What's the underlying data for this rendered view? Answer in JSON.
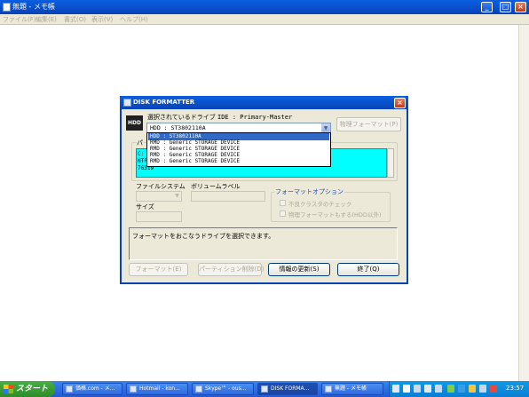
{
  "notepad": {
    "title": "無題 - メモ帳",
    "menu": [
      "ファイル(F)",
      "編集(E)",
      "書式(O)",
      "表示(V)",
      "ヘルプ(H)"
    ],
    "buttons": {
      "minimize": "_",
      "maximize": "□",
      "close": "×"
    }
  },
  "dialog": {
    "title": "DISK FORMATTER",
    "close": "×",
    "hdd_icon": "HDD",
    "selected_drive_label": "選択されているドライブ",
    "ide_label": "IDE : Primary-Master",
    "drive_value": "HDD : ST3802110A",
    "drive_options": [
      "HDD : ST3802110A",
      "RMD : Generic STORAGE DEVICE",
      "RMD : Generic STORAGE DEVICE",
      "RMD : Generic STORAGE DEVICE",
      "RMD : Generic STORAGE DEVICE"
    ],
    "physical_format_button": "物理フォーマット(P)",
    "partition_label": "パ",
    "partition_lines": [
      "C:",
      "NTFS",
      "76319"
    ],
    "filesystem_label": "ファイルシステム",
    "volume_label": "ボリュームラベル",
    "size_label": "サイズ",
    "format_options_label": "フォーマットオプション",
    "option_bad_cluster": "不良クラスタのチェック",
    "option_physical": "物理フォーマットもする(HDD以外)",
    "status_text": "フォーマットをおこなうドライブを選択できます。",
    "buttons": {
      "format": "フォーマット(E)",
      "delete_partition": "パーティション削除(D)",
      "refresh": "情報の更新(S)",
      "exit": "終了(Q)"
    }
  },
  "taskbar": {
    "start": "スタート",
    "tasks": [
      "価格.com - メ...",
      "Hotmail - kon...",
      "Skype™ - ous...",
      "DISK FORMA...",
      "無題 - メモ帳"
    ],
    "clock": "23:57"
  }
}
